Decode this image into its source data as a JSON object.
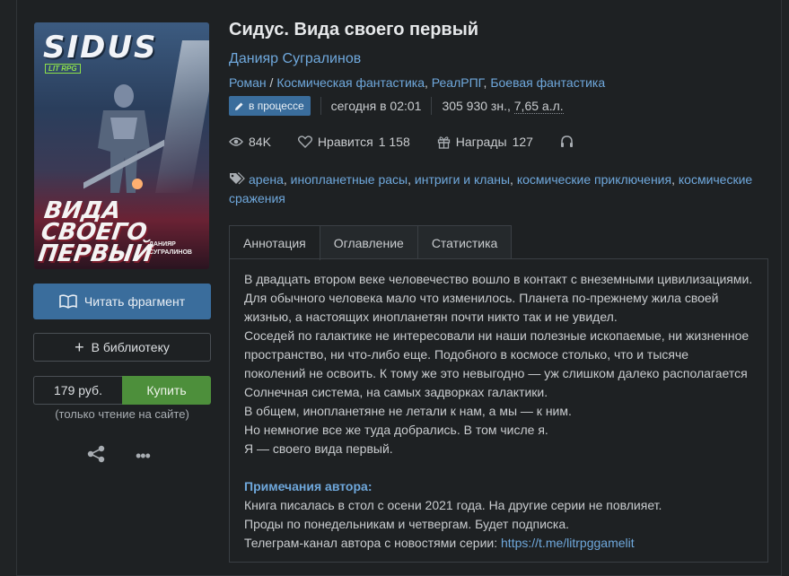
{
  "cover": {
    "logo": "SIDUS",
    "series_badge": "LIT RPG",
    "title_text": "ВИДА СВОЕГО ПЕРВЫЙ",
    "author_text": "ДАНИЯР СУГРАЛИНОВ"
  },
  "actions": {
    "read_fragment": "Читать фрагмент",
    "add_library": "В библиотеку",
    "price": "179 руб.",
    "buy": "Купить",
    "buy_note": "(только чтение на сайте)"
  },
  "book": {
    "title": "Сидус. Вида своего первый",
    "author": "Данияр Сугралинов",
    "genres": [
      "Роман",
      "Космическая фантастика",
      "РеалРПГ",
      "Боевая фантастика"
    ],
    "status": "в процессе",
    "updated": "сегодня в 02:01",
    "size_chars": "305 930 зн.,",
    "size_al": "7,65 а.л."
  },
  "stats": {
    "views": "84K",
    "likes_label": "Нравится",
    "likes": "1 158",
    "awards_label": "Награды",
    "awards": "127"
  },
  "tags": [
    "арена",
    "инопланетные расы",
    "интриги и кланы",
    "космические приключения",
    "космические сражения"
  ],
  "tabs": [
    "Аннотация",
    "Оглавление",
    "Статистика"
  ],
  "annotation": [
    "В двадцать втором веке человечество вошло в контакт с внеземными цивилизациями.",
    "Для обычного человека мало что изменилось. Планета по-прежнему жила своей",
    "жизнью, а настоящих инопланетян почти никто так и не увидел.",
    "Соседей по галактике не интересовали ни наши полезные ископаемые, ни жизненное",
    "пространство, ни что-либо еще. Подобного в космосе столько, что и тысяче",
    "поколений не освоить. К тому же это невыгодно — уж слишком далеко располагается",
    "Солнечная система, на самых задворках галактики.",
    "В общем, инопланетяне не летали к нам, а мы — к ним.",
    "Но немногие все же туда добрались. В том числе я.",
    "Я — своего вида первый."
  ],
  "author_notes": {
    "title": "Примечания автора:",
    "lines": [
      "Книга писалась в стол с осени 2021 года. На другие серии не повлияет.",
      "Проды по понедельникам и четвергам. Будет подписка."
    ],
    "channel_prefix": "Телеграм-канал автора с новостями серии: ",
    "channel_link": "https://t.me/litrpggamelit"
  }
}
